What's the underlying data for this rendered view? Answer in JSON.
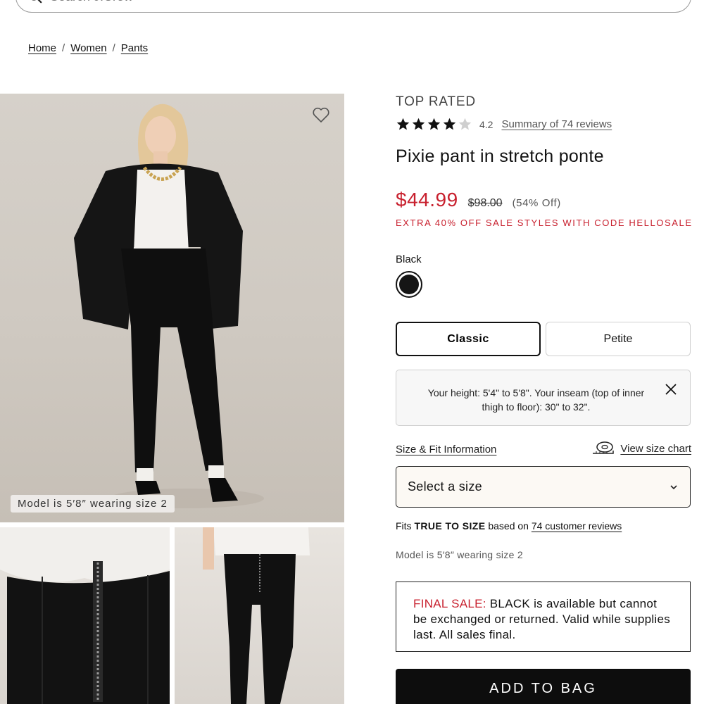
{
  "search": {
    "placeholder": "Search J.Crew",
    "icon": "search-icon"
  },
  "breadcrumb": [
    {
      "label": "Home"
    },
    {
      "label": "Women"
    },
    {
      "label": "Pants"
    }
  ],
  "gallery": {
    "hero_badge": "Model is 5′8″ wearing size 2",
    "wishlist_icon": "heart-icon"
  },
  "product": {
    "badge": "TOP RATED",
    "rating": 4.2,
    "rating_label": "4.2",
    "review_link": "Summary of 74 reviews",
    "title": "Pixie pant in stretch ponte",
    "sale_price": "$44.99",
    "original_price": "$98.00",
    "percent_off": "(54% Off)",
    "promo": "EXTRA 40% OFF SALE STYLES WITH CODE HELLOSALE",
    "color_name": "Black",
    "color_hex": "#151515",
    "sale_color": "#c8202e"
  },
  "fit_tabs": [
    {
      "label": "Classic",
      "selected": true
    },
    {
      "label": "Petite",
      "selected": false
    }
  ],
  "height_info": {
    "text": "Your height: 5'4\" to 5'8\". Your inseam (top of inner thigh to floor): 30\" to 32\"."
  },
  "size": {
    "fit_info_link": "Size & Fit Information",
    "chart_link": "View size chart",
    "select_label": "Select a size"
  },
  "fits": {
    "prefix": "Fits",
    "strong": "TRUE TO SIZE",
    "middle": "based on",
    "link": "74 customer reviews"
  },
  "model_note": "Model is 5′8″ wearing size 2",
  "final_sale": {
    "label": "FINAL SALE:",
    "text": "BLACK is available but cannot be exchanged or returned. Valid while supplies last. All sales final."
  },
  "add_to_bag": "ADD TO BAG"
}
